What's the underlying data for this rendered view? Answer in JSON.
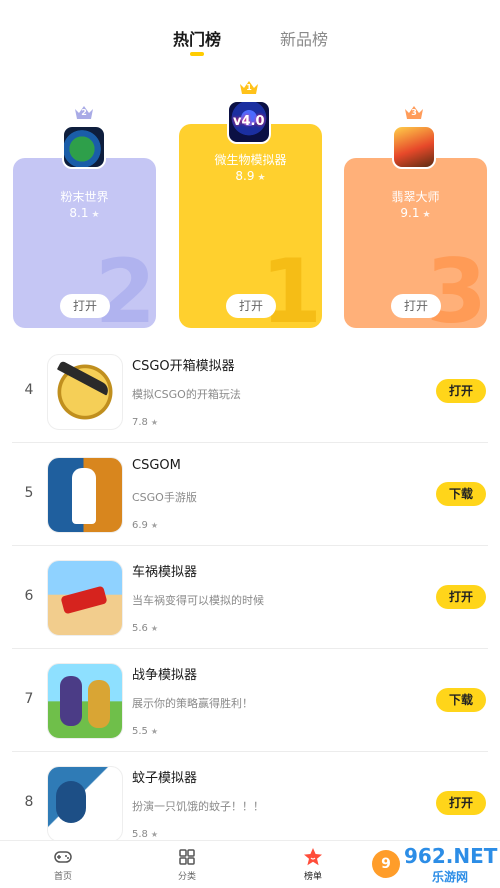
{
  "tabs": {
    "hot": "热门榜",
    "new": "新品榜"
  },
  "podium": [
    {
      "rank": "2",
      "name": "粉末世界",
      "score": "8.1",
      "button": "打开",
      "big_number": "2",
      "icon": "powder-world-icon",
      "color": "#c5c6f4"
    },
    {
      "rank": "1",
      "name": "微生物模拟器",
      "score": "8.9",
      "button": "打开",
      "big_number": "1",
      "icon": "microbe-sim-icon",
      "icon_text": "v4.0",
      "color": "#ffd02e"
    },
    {
      "rank": "3",
      "name": "翡翠大师",
      "score": "9.1",
      "button": "打开",
      "big_number": "3",
      "icon": "jade-master-icon",
      "color": "#ffb079"
    }
  ],
  "list": [
    {
      "rank": "4",
      "title": "CSGO开箱模拟器",
      "desc": "模拟CSGO的开箱玩法",
      "score": "7.8",
      "action": "打开"
    },
    {
      "rank": "5",
      "title": "CSGOM",
      "desc": "CSGO手游版",
      "score": "6.9",
      "action": "下载"
    },
    {
      "rank": "6",
      "title": "车祸模拟器",
      "desc": "当车祸变得可以模拟的时候",
      "score": "5.6",
      "action": "打开"
    },
    {
      "rank": "7",
      "title": "战争模拟器",
      "desc": "展示你的策略赢得胜利！",
      "score": "5.5",
      "action": "下载"
    },
    {
      "rank": "8",
      "title": "蚊子模拟器",
      "desc": "扮演一只饥饿的蚊子！！！",
      "score": "5.8",
      "action": "打开"
    }
  ],
  "star": "★",
  "bottom_nav": {
    "home": "首页",
    "category": "分类",
    "ranking": "榜单"
  },
  "watermark": {
    "main": "962.NET",
    "sub": "乐游网",
    "bubble": "9"
  },
  "colors": {
    "accent": "#ffd51a",
    "tab_underline": "#ffcc00",
    "nav_active": "#ff4d3a"
  }
}
